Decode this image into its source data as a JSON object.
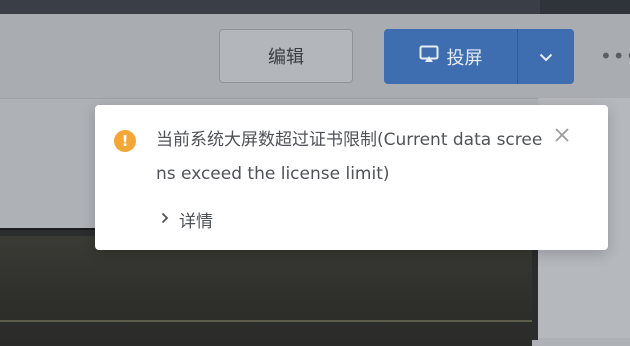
{
  "toolbar": {
    "edit_label": "编辑",
    "cast_label": "投屏"
  },
  "notification": {
    "message": "当前系统大屏数超过证书限制(Current data screens exceed the license limit)",
    "details_label": "详情",
    "warning_symbol": "!"
  },
  "colors": {
    "primary": "#3f6eb0",
    "warning": "#f4a637"
  },
  "icons": [
    "cast-icon",
    "chevron-down-icon",
    "more-icon",
    "warning-icon",
    "close-icon",
    "chevron-right-icon"
  ]
}
